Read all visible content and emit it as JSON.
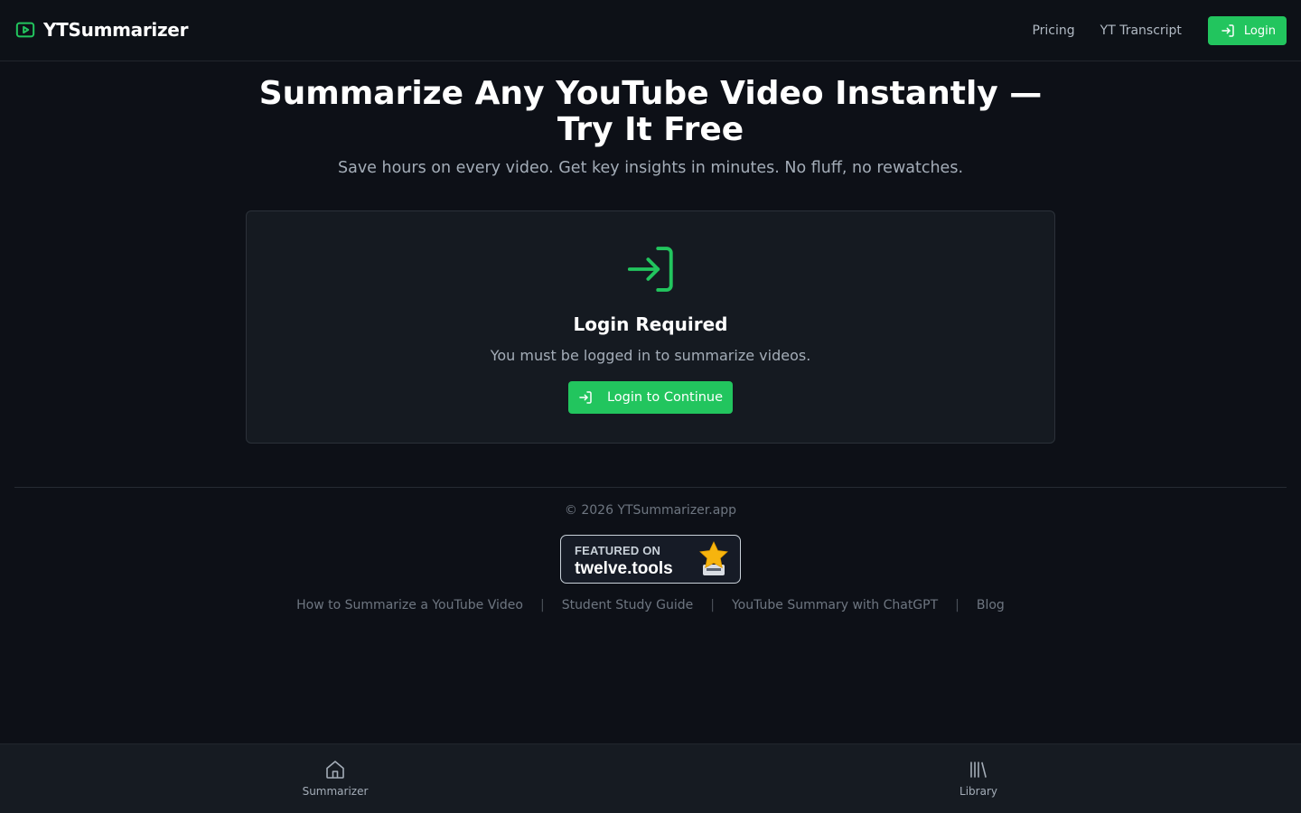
{
  "brand": {
    "name": "YTSummarizer",
    "icon": "play-box-icon",
    "accent_color": "#22c55e"
  },
  "nav": {
    "links": [
      "Pricing",
      "YT Transcript"
    ],
    "login_label": "Login"
  },
  "hero": {
    "title": "Summarize Any YouTube Video Instantly — Try It Free",
    "subtitle": "Save hours on every video. Get key insights in minutes. No fluff, no rewatches."
  },
  "login_card": {
    "icon": "login-icon",
    "title": "Login Required",
    "message": "You must be logged in to summarize videos.",
    "button_label": "Login to Continue"
  },
  "footer": {
    "copyright": "© 2026 YTSummarizer.app",
    "badge": {
      "top": "FEATURED ON",
      "name": "twelve.tools",
      "icon": "star-trophy-icon"
    },
    "links": [
      "How to Summarize a YouTube Video",
      "Student Study Guide",
      "YouTube Summary with ChatGPT",
      "Blog"
    ],
    "separator": "|"
  },
  "bottom_nav": {
    "items": [
      {
        "label": "Summarizer",
        "icon": "home-icon"
      },
      {
        "label": "Library",
        "icon": "library-icon"
      }
    ]
  }
}
